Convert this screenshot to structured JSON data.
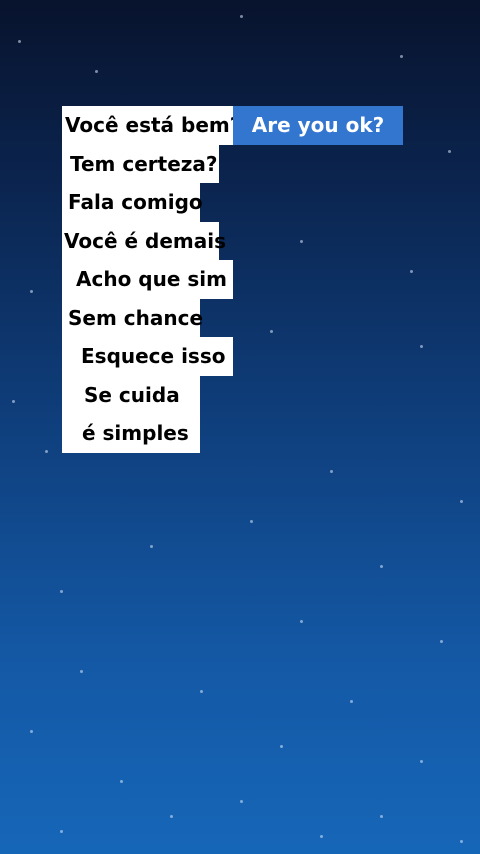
{
  "phrases": [
    {
      "label": "Você está bem?"
    },
    {
      "label": "Tem certeza?"
    },
    {
      "label": "Fala comigo"
    },
    {
      "label": "Você é demais"
    },
    {
      "label": "Acho que sim"
    },
    {
      "label": "Sem chance"
    },
    {
      "label": "Esquece isso"
    },
    {
      "label": "Se cuida"
    },
    {
      "label": "é simples"
    }
  ],
  "translation": {
    "label": "Are you ok?"
  },
  "colors": {
    "tile_background": "#ffffff",
    "translation_background": "#3376cf",
    "background_top": "#08132d",
    "background_bottom": "#1666b8"
  }
}
